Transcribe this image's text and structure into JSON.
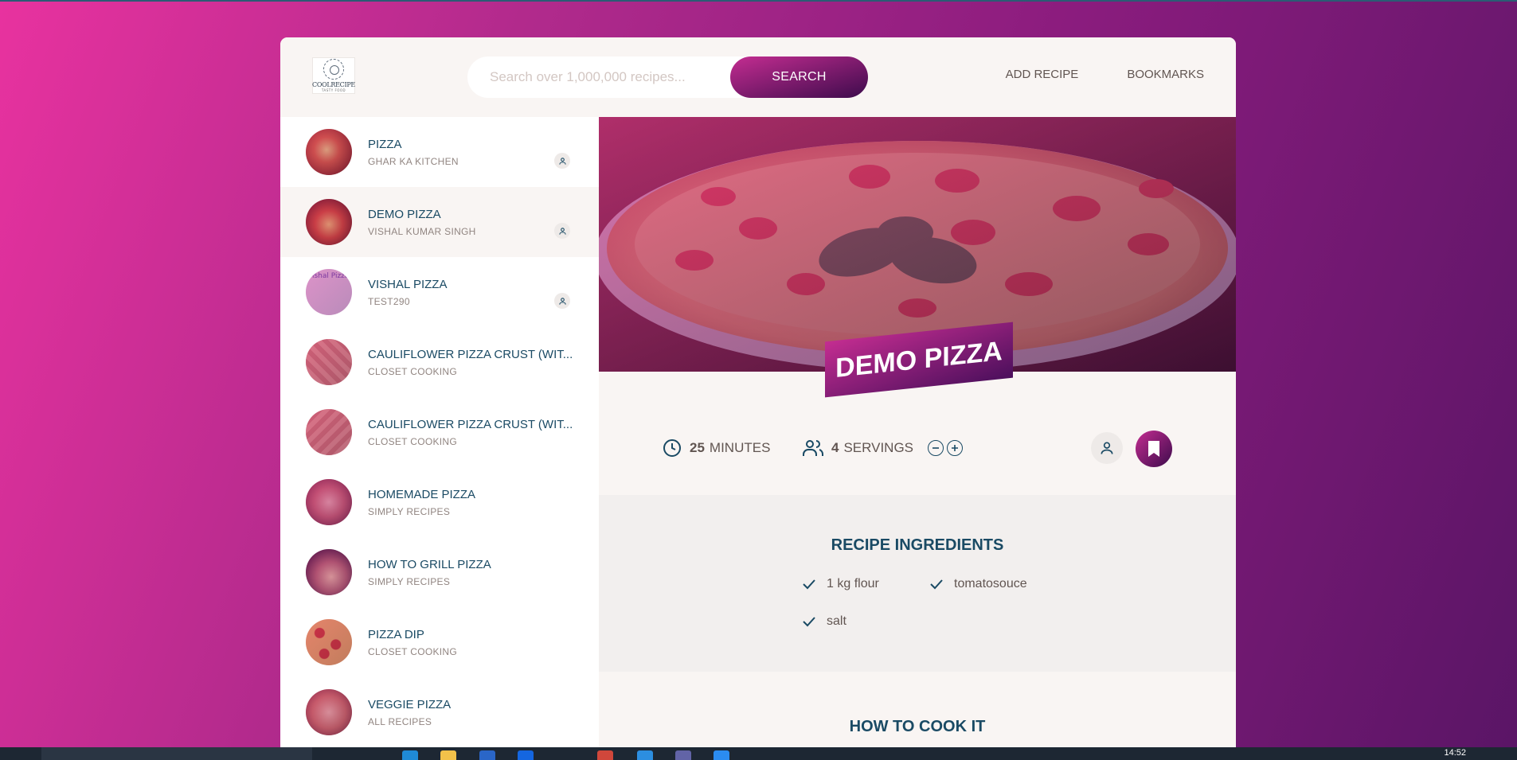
{
  "header": {
    "logo_text": "COOLRECIPE",
    "logo_sub": "TASTY FOOD",
    "search_placeholder": "Search over 1,000,000 recipes...",
    "search_button": "SEARCH",
    "nav": [
      "ADD RECIPE",
      "BOOKMARKS"
    ]
  },
  "results": [
    {
      "title": "PIZZA",
      "publisher": "GHAR KA KITCHEN",
      "user_generated": true,
      "active": false
    },
    {
      "title": "DEMO PIZZA",
      "publisher": "VISHAL KUMAR SINGH",
      "user_generated": true,
      "active": true
    },
    {
      "title": "VISHAL PIZZA",
      "publisher": "TEST290",
      "user_generated": true,
      "active": false,
      "broken_image_alt": "Vishal Pizza"
    },
    {
      "title": "CAULIFLOWER PIZZA CRUST (WIT...",
      "publisher": "CLOSET COOKING",
      "user_generated": false
    },
    {
      "title": "CAULIFLOWER PIZZA CRUST (WIT...",
      "publisher": "CLOSET COOKING",
      "user_generated": false
    },
    {
      "title": "HOMEMADE PIZZA",
      "publisher": "SIMPLY RECIPES",
      "user_generated": false
    },
    {
      "title": "HOW TO GRILL PIZZA",
      "publisher": "SIMPLY RECIPES",
      "user_generated": false
    },
    {
      "title": "PIZZA DIP",
      "publisher": "CLOSET COOKING",
      "user_generated": false
    },
    {
      "title": "VEGGIE PIZZA",
      "publisher": "ALL RECIPES",
      "user_generated": false
    }
  ],
  "recipe": {
    "title": "DEMO PIZZA",
    "cooking_time": "25",
    "cooking_time_unit": "MINUTES",
    "servings": "4",
    "servings_unit": "SERVINGS",
    "ingredients_heading": "RECIPE INGREDIENTS",
    "ingredients": [
      "1 kg flour",
      "tomatosouce",
      "salt"
    ],
    "cook_heading": "HOW TO COOK IT"
  },
  "taskbar": {
    "time": "14:52"
  },
  "colors": {
    "accent_start": "#e8329f",
    "accent_end": "#3d0b4c",
    "heading": "#1a4a64",
    "text": "#615551"
  }
}
